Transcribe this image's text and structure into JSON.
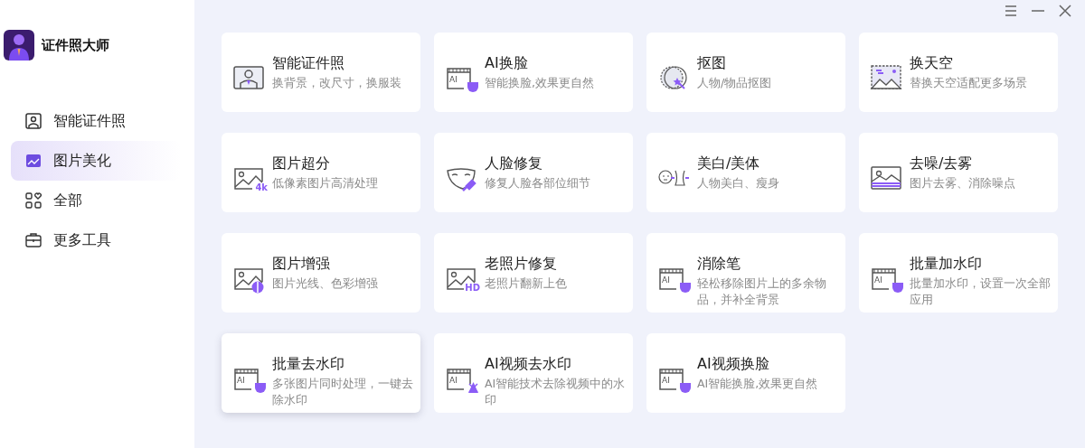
{
  "app": {
    "title": "证件照大师"
  },
  "sidebar": {
    "items": [
      {
        "label": "智能证件照",
        "kind": "id",
        "selected": false
      },
      {
        "label": "图片美化",
        "kind": "beauty",
        "selected": true
      },
      {
        "label": "全部",
        "kind": "grid",
        "selected": false
      },
      {
        "label": "更多工具",
        "kind": "toolbox",
        "selected": false
      }
    ]
  },
  "tools": [
    {
      "title": "智能证件照",
      "subtitle": "换背景，改尺寸，换服装",
      "kind": "id-photo",
      "highlighted": false
    },
    {
      "title": "AI换脸",
      "subtitle": "智能换脸,效果更自然",
      "kind": "ai-mask",
      "icon_text": "AI",
      "highlighted": false
    },
    {
      "title": "抠图",
      "subtitle": "人物/物品抠图",
      "kind": "cutout",
      "highlighted": false
    },
    {
      "title": "换天空",
      "subtitle": "替换天空适配更多场景",
      "kind": "sky",
      "highlighted": false
    },
    {
      "title": "图片超分",
      "subtitle": "低像素图片高清处理",
      "kind": "image-badge",
      "icon_text": "4k",
      "highlighted": false
    },
    {
      "title": "人脸修复",
      "subtitle": "修复人脸各部位细节",
      "kind": "face-mask",
      "highlighted": false
    },
    {
      "title": "美白/美体",
      "subtitle": "人物美白、瘦身",
      "kind": "body",
      "highlighted": false
    },
    {
      "title": "去噪/去雾",
      "subtitle": "图片去雾、消除噪点",
      "kind": "denoise",
      "highlighted": false
    },
    {
      "title": "图片增强",
      "subtitle": "图片光线、色彩增强",
      "kind": "enhance",
      "highlighted": false
    },
    {
      "title": "老照片修复",
      "subtitle": "老照片翻新上色",
      "kind": "image-badge",
      "icon_text": "HD",
      "highlighted": false
    },
    {
      "title": "消除笔",
      "subtitle": "轻松移除图片上的多余物品，并补全背景",
      "kind": "ai-mask",
      "icon_text": "AI",
      "highlighted": false
    },
    {
      "title": "批量加水印",
      "subtitle": "批量加水印，设置一次全部应用",
      "kind": "ai-mask",
      "icon_text": "AI",
      "highlighted": false
    },
    {
      "title": "批量去水印",
      "subtitle": "多张图片同时处理，一键去除水印",
      "kind": "ai-mask",
      "icon_text": "AI",
      "highlighted": true
    },
    {
      "title": "AI视频去水印",
      "subtitle": "AI智能技术去除视频中的水印",
      "kind": "ai-cross",
      "icon_text": "AI",
      "highlighted": false
    },
    {
      "title": "AI视频换脸",
      "subtitle": "AI智能换脸,效果更自然",
      "kind": "ai-mask",
      "icon_text": "AI",
      "highlighted": false
    }
  ]
}
